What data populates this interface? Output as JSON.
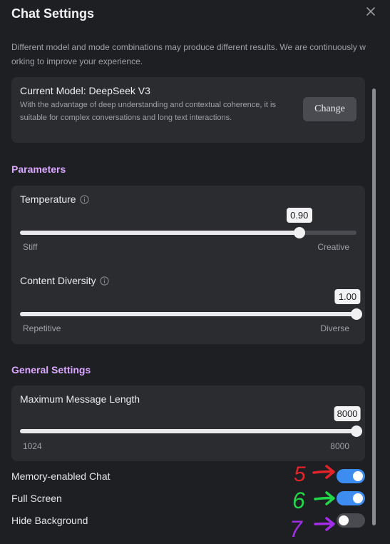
{
  "dialog": {
    "title": "Chat Settings",
    "note": "Different model and mode combinations may produce different results. We are continuously working to improve your experience."
  },
  "model": {
    "title": "Current Model: DeepSeek V3",
    "description": "With the advantage of deep understanding and contextual coherence, it is suitable for complex conversations and long text interactions.",
    "change_label": "Change"
  },
  "parameters": {
    "heading": "Parameters",
    "temperature": {
      "label": "Temperature",
      "value": "0.90",
      "fraction": 0.83,
      "min_label": "Stiff",
      "max_label": "Creative"
    },
    "diversity": {
      "label": "Content Diversity",
      "value": "1.00",
      "fraction": 1.0,
      "min_label": "Repetitive",
      "max_label": "Diverse"
    }
  },
  "general": {
    "heading": "General Settings",
    "max_length": {
      "label": "Maximum Message Length",
      "value": "8000",
      "fraction": 1.0,
      "min_label": "1024",
      "max_label": "8000"
    },
    "toggles": [
      {
        "label": "Memory-enabled Chat",
        "on": true
      },
      {
        "label": "Full Screen",
        "on": true
      },
      {
        "label": "Hide Background",
        "on": false
      }
    ]
  },
  "annotations": [
    {
      "number": "5",
      "color": "#e0242a"
    },
    {
      "number": "6",
      "color": "#22d64a"
    },
    {
      "number": "7",
      "color": "#a22ee8"
    }
  ],
  "icons": {
    "close": "close-icon",
    "info": "info-icon"
  }
}
